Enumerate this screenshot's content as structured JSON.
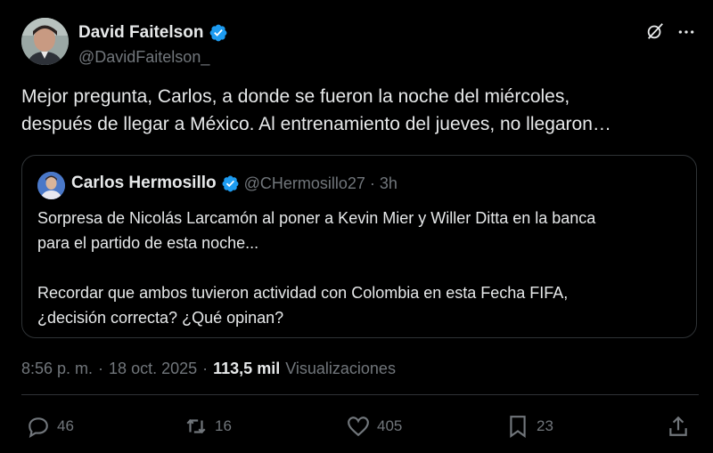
{
  "author": {
    "display_name": "David Faitelson",
    "handle": "@DavidFaitelson_"
  },
  "tweet": {
    "lines": [
      "Mejor pregunta, Carlos, a donde se fueron la noche del miércoles,",
      "después de llegar a México. Al entrenamiento del jueves, no llegaron…"
    ]
  },
  "quote": {
    "display_name": "Carlos Hermosillo",
    "handle": "@CHermosillo27",
    "separator": "·",
    "time": "3h",
    "lines": [
      "Sorpresa de Nicolás Larcamón al poner a Kevin Mier y Willer Ditta en la banca",
      "para el partido de esta noche...",
      "",
      "Recordar que ambos tuvieron actividad con Colombia en esta  Fecha FIFA,",
      "¿decisión correcta? ¿Qué opinan?"
    ]
  },
  "meta": {
    "time": "8:56 p. m.",
    "sep1": "·",
    "date": "18 oct. 2025",
    "sep2": "·",
    "views_count": "113,5 mil",
    "views_label": "Visualizaciones"
  },
  "actions": {
    "replies": "46",
    "reposts": "16",
    "likes": "405",
    "bookmarks": "23"
  },
  "icons": {
    "verified": "verified-badge-icon",
    "grok": "grok-icon",
    "more": "more-icon",
    "reply": "reply-icon",
    "repost": "repost-icon",
    "like": "heart-icon",
    "bookmark": "bookmark-icon",
    "share": "share-icon"
  },
  "colors": {
    "background": "#000000",
    "text": "#e7e9ea",
    "muted": "#71767b",
    "verified": "#1d9bf0",
    "border": "#2f3336"
  }
}
